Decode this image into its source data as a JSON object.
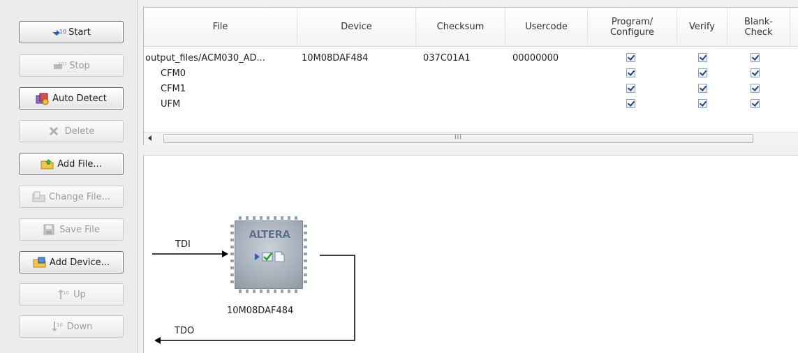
{
  "buttons": [
    {
      "label": "Start",
      "icon": "start-icon",
      "enabled": true
    },
    {
      "label": "Stop",
      "icon": "stop-icon",
      "enabled": false
    },
    {
      "label": "Auto Detect",
      "icon": "auto-detect-icon",
      "enabled": true
    },
    {
      "label": "Delete",
      "icon": "delete-icon",
      "enabled": false
    },
    {
      "label": "Add File...",
      "icon": "add-file-icon",
      "enabled": true
    },
    {
      "label": "Change File...",
      "icon": "change-file-icon",
      "enabled": false
    },
    {
      "label": "Save File",
      "icon": "save-file-icon",
      "enabled": false
    },
    {
      "label": "Add Device...",
      "icon": "add-device-icon",
      "enabled": true
    },
    {
      "label": "Up",
      "icon": "up-icon",
      "enabled": false
    },
    {
      "label": "Down",
      "icon": "down-icon",
      "enabled": false
    }
  ],
  "table": {
    "headers": {
      "file": "File",
      "device": "Device",
      "checksum": "Checksum",
      "usercode": "Usercode",
      "program_1": "Program/",
      "program_2": "Configure",
      "verify": "Verify",
      "blank_1": "Blank-",
      "blank_2": "Check"
    },
    "rows": [
      {
        "file": "output_files/ACM030_AD...",
        "device": "10M08DAF484",
        "checksum": "037C01A1",
        "usercode": "00000000",
        "program": true,
        "verify": true,
        "blank": true
      },
      {
        "file": "CFM0",
        "device": "",
        "checksum": "",
        "usercode": "",
        "program": true,
        "verify": true,
        "blank": true
      },
      {
        "file": "CFM1",
        "device": "",
        "checksum": "",
        "usercode": "",
        "program": true,
        "verify": true,
        "blank": true
      },
      {
        "file": "UFM",
        "device": "",
        "checksum": "",
        "usercode": "",
        "program": true,
        "verify": true,
        "blank": true
      }
    ]
  },
  "scrollbar": {
    "grip": "III"
  },
  "chain": {
    "tdi_label": "TDI",
    "tdo_label": "TDO",
    "device_name": "10M08DAF484",
    "chip_logo": "ALTERA"
  }
}
